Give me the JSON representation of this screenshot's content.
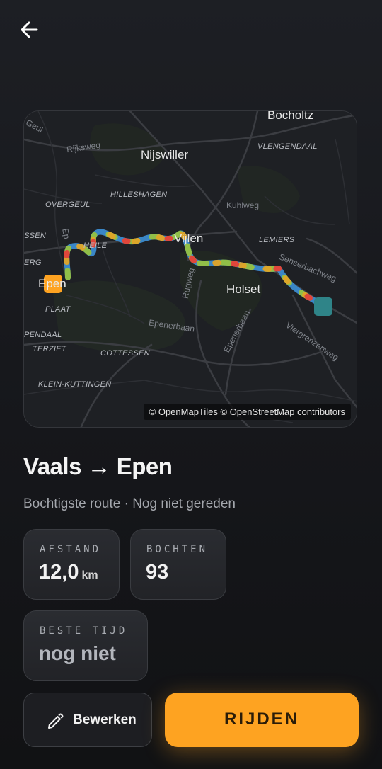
{
  "header": {
    "back_icon": "arrow-left-icon"
  },
  "map": {
    "labels": {
      "bocholtz": "Bocholtz",
      "geul": "Geul",
      "rijksweg": "Rijksweg",
      "nijswiller": "Nijswiller",
      "vlengendaal": "VLENGENDAAL",
      "hilleshagen": "HILLESHAGEN",
      "overgeul": "OVERGEUL",
      "kuhlweg": "Kuhlweg",
      "essen": "SSEN",
      "erg": "ERG",
      "heile": "HEILE",
      "vijlen": "Vijlen",
      "lemiers": "LEMIERS",
      "senserbachweg": "Senserbachweg",
      "epen": "Epen",
      "plaat": "PLAAT",
      "holset": "Holset",
      "rugweg": "Rugweg",
      "epenerbaan": "Epenerbaan",
      "epenerbaan2": "Epenerbaan",
      "viergrenzenweg": "Viergrenzenweg",
      "pendaal": "PENDAAL",
      "terziet": "TERZIET",
      "cottessen": "COTTESSEN",
      "kleinkuttingen": "KLEIN-KUTTINGEN",
      "ep": "Ep"
    },
    "attribution": "© OpenMapTiles © OpenStreetMap contributors",
    "start_marker_color": "#fea321",
    "end_marker_color": "#2f8488"
  },
  "route": {
    "title": "Vaals → Epen",
    "subtitle": "Bochtigste route · Nog niet gereden"
  },
  "stats": {
    "distance": {
      "label": "AFSTAND",
      "value": "12,0",
      "unit": "km"
    },
    "bends": {
      "label": "BOCHTEN",
      "value": "93"
    },
    "best_time": {
      "label": "BESTE TIJD",
      "value": "nog niet"
    }
  },
  "actions": {
    "edit_label": "Bewerken",
    "edit_icon": "pencil-icon",
    "ride_label": "RIJDEN"
  },
  "colors": {
    "accent": "#fea321",
    "background": "#17181c"
  }
}
